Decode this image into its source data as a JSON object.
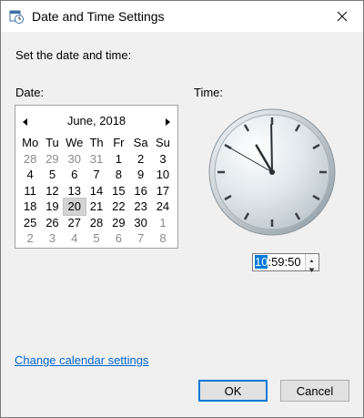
{
  "window": {
    "title": "Date and Time Settings"
  },
  "heading": "Set the date and time:",
  "date_label": "Date:",
  "time_label": "Time:",
  "calendar": {
    "month_year": "June, 2018",
    "weekdays": [
      "Mo",
      "Tu",
      "We",
      "Th",
      "Fr",
      "Sa",
      "Su"
    ],
    "weeks": [
      [
        "28",
        "29",
        "30",
        "31",
        "1",
        "2",
        "3"
      ],
      [
        "4",
        "5",
        "6",
        "7",
        "8",
        "9",
        "10"
      ],
      [
        "11",
        "12",
        "13",
        "14",
        "15",
        "16",
        "17"
      ],
      [
        "18",
        "19",
        "20",
        "21",
        "22",
        "23",
        "24"
      ],
      [
        "25",
        "26",
        "27",
        "28",
        "29",
        "30",
        "1"
      ],
      [
        "2",
        "3",
        "4",
        "5",
        "6",
        "7",
        "8"
      ]
    ],
    "selected": "20"
  },
  "time": {
    "hours": "10",
    "rest": ":59:50"
  },
  "link": "Change calendar settings",
  "buttons": {
    "ok": "OK",
    "cancel": "Cancel"
  },
  "icons": {
    "title": "calendar-clock-icon",
    "close": "close-icon",
    "prev": "chevron-left-icon",
    "next": "chevron-right-icon"
  }
}
